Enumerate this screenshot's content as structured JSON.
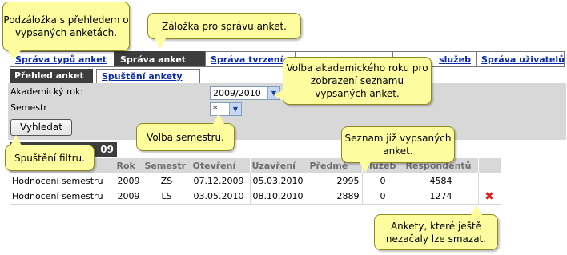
{
  "main_tabs": [
    {
      "label": "Správa typů anket",
      "active": false
    },
    {
      "label": "Správa anket",
      "active": true
    },
    {
      "label": "Správa tvrzení",
      "active": false
    },
    {
      "label": "",
      "active": false
    },
    {
      "label": "služeb",
      "active": false
    },
    {
      "label": "Správa uživatelů",
      "active": false
    }
  ],
  "sub_tabs": [
    {
      "label": "Přehled anket",
      "active": true
    },
    {
      "label": "Spuštění ankety",
      "active": false
    }
  ],
  "filter": {
    "year_label": "Akademický rok:",
    "year_value": "2009/2010",
    "semester_label": "Semestr",
    "semester_value": "*",
    "search_button": "Vyhledat"
  },
  "result_tab_label": "09",
  "table": {
    "headers": [
      "",
      "Rok",
      "Semestr",
      "Otevření",
      "Uzavření",
      "Předmě",
      "služeb",
      "Respondentů",
      ""
    ],
    "rows": [
      {
        "name": "Hodnocení semestru",
        "year": "2009",
        "semester": "ZS",
        "opened": "07.12.2009",
        "closed": "05.03.2010",
        "subjects": "2995",
        "services": "0",
        "respondents": "4584",
        "deletable": false
      },
      {
        "name": "Hodnocení semestru",
        "year": "2009",
        "semester": "LS",
        "opened": "03.05.2010",
        "closed": "08.10.2010",
        "subjects": "2889",
        "services": "0",
        "respondents": "1274",
        "deletable": true
      }
    ]
  },
  "callouts": {
    "subtab_overview": "Podzáložka s přehledem o vypsaných anketách.",
    "tab_manage": "Záložka pro správu anket.",
    "year_choice": "Volba akademického roku pro zobrazení seznamu vypsaných anket.",
    "semester_choice": "Volba semestru.",
    "run_filter": "Spuštění filtru.",
    "list": "Seznam již vypsaných anket.",
    "delete": "Ankety, které ještě nezačaly lze smazat."
  },
  "colors": {
    "tab_active": "#3d3d3d",
    "link": "#0a2aa8",
    "panel": "#d8d8d8",
    "callout": "#fdfd9f",
    "delete": "#e02020"
  },
  "icons": {
    "dropdown": "chevron-down-icon",
    "delete": "delete-x-icon"
  }
}
